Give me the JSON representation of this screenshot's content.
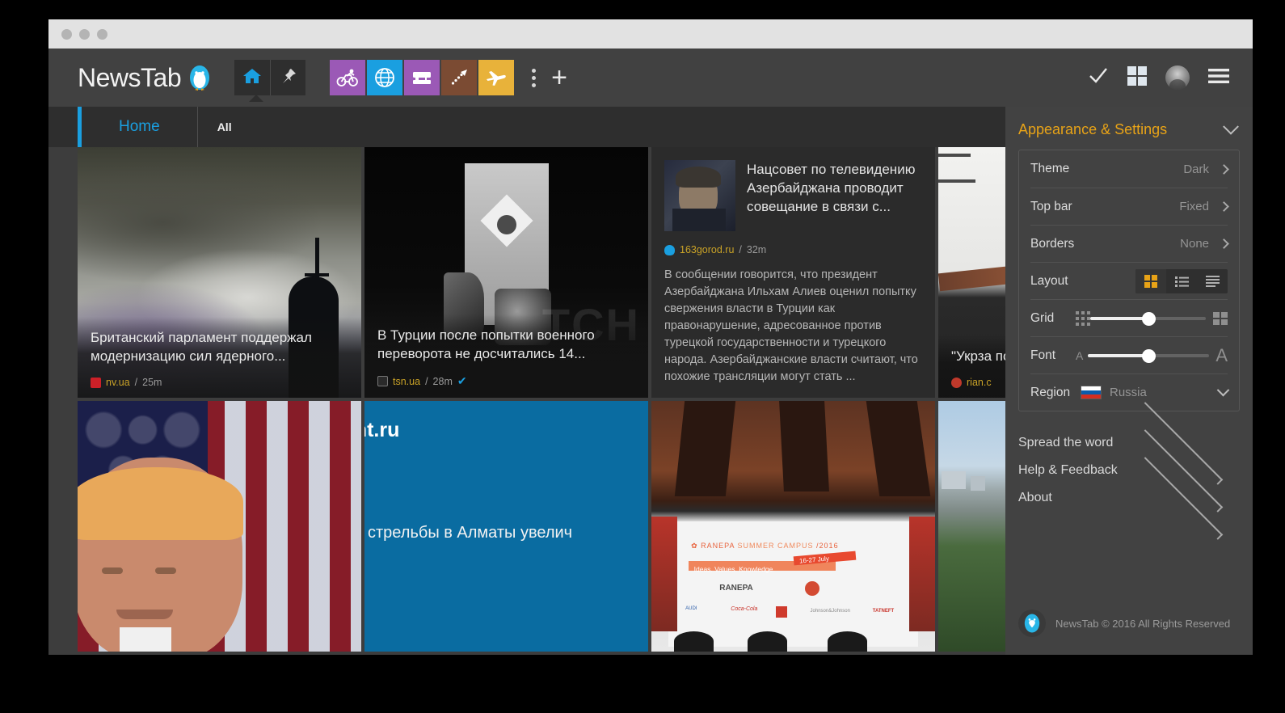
{
  "window": {
    "dots": [
      "close",
      "minimize",
      "maximize"
    ]
  },
  "topbar": {
    "brand": "NewsTab",
    "brand_icon": "penguin-logo",
    "nav": [
      {
        "name": "home",
        "icon": "home-icon",
        "active": true
      },
      {
        "name": "pin",
        "icon": "pin-icon",
        "active": false
      }
    ],
    "categories": [
      {
        "name": "cycling",
        "icon": "bicycle-icon",
        "color": "#9b59b6"
      },
      {
        "name": "world",
        "icon": "globe-icon",
        "color": "#1a9fe0"
      },
      {
        "name": "crafts",
        "icon": "sewing-machine-icon",
        "color": "#9b59b6"
      },
      {
        "name": "trending",
        "icon": "arrow-up-icon",
        "color": "#7b4b33"
      },
      {
        "name": "travel",
        "icon": "airplane-icon",
        "color": "#e8b23a"
      }
    ],
    "more_icon": "kebab-menu-icon",
    "add_label": "+",
    "right_icons": [
      {
        "name": "mark-read",
        "icon": "check-icon"
      },
      {
        "name": "view-grid",
        "icon": "grid-icon"
      },
      {
        "name": "account",
        "icon": "avatar"
      },
      {
        "name": "main-menu",
        "icon": "hamburger-icon"
      }
    ]
  },
  "tabs": [
    {
      "label": "Home",
      "active": true
    },
    {
      "label": "All",
      "active": false
    }
  ],
  "cards": [
    {
      "type": "photo",
      "name": "card-uk-parliament",
      "title": "Британский парламент поддержал модернизацию сил ядерного...",
      "source": "nv.ua",
      "time": "25m",
      "favicon_color": "#cc2028",
      "verified": false,
      "image": "submarine-cloudy-sky"
    },
    {
      "type": "photo",
      "name": "card-turkey-coup",
      "title": "В Турции после попытки военного переворота не досчитались 14...",
      "source": "tsn.ua",
      "time": "28m",
      "favicon_color": "#2a2a2a",
      "verified": true,
      "image": "taksim-monument-bw"
    },
    {
      "type": "text",
      "name": "card-azerbaijan-tv",
      "title": "Нацсовет по телевидению Азербайджана проводит совещание в связи с...",
      "source": "163gorod.ru",
      "time": "32m",
      "favicon_color": "#1a9fe0",
      "body": "В сообщении говорится, что президент Азербайджана Ильхам Алиев оценил попытку свержения власти в Турции как правонарушение, адресованное против турецкой государственности и турецкого народа. Азербайджанские власти считают, что похожие трансляции могут стать ...",
      "image": "erdogan-portrait-thumb"
    },
    {
      "type": "photo",
      "name": "card-ukrzaliznytsia",
      "title": "\"Укрза похищ",
      "source": "rian.c",
      "time": "",
      "favicon_color": "#c0392b",
      "verified": false,
      "image": "white-building-interior",
      "clipped": true
    },
    {
      "type": "photo",
      "name": "card-trump",
      "title": "",
      "source": "",
      "time": "",
      "image": "trump-us-flag"
    },
    {
      "type": "blue",
      "name": "card-kommersant-almaty",
      "brand": "sant.ru",
      "title": "отв стрельбы в Алматы увелич",
      "bg_color": "#0a6ca1"
    },
    {
      "type": "photo",
      "name": "card-ranepa-campus",
      "title": "",
      "source": "",
      "time": "",
      "image": "ranepa-summer-campus-2016"
    },
    {
      "type": "photo",
      "name": "card-city-river",
      "title": "",
      "source": "",
      "time": "",
      "image": "city-river-aerial",
      "clipped": true
    }
  ],
  "settings": {
    "title": "Appearance & Settings",
    "collapse_icon": "chevron-down-icon",
    "rows": [
      {
        "label": "Theme",
        "value": "Dark",
        "type": "link"
      },
      {
        "label": "Top bar",
        "value": "Fixed",
        "type": "link"
      },
      {
        "label": "Borders",
        "value": "None",
        "type": "link"
      }
    ],
    "layout": {
      "label": "Layout",
      "options": [
        {
          "name": "grid-layout",
          "icon": "grid-icon",
          "active": true
        },
        {
          "name": "list-layout",
          "icon": "list-icon",
          "active": false
        },
        {
          "name": "compact-layout",
          "icon": "lines-icon",
          "active": false
        }
      ],
      "accent": "#e8a317"
    },
    "grid_slider": {
      "label": "Grid",
      "value": 50,
      "min_icon": "dense-grid-icon",
      "max_icon": "large-grid-icon"
    },
    "font_slider": {
      "label": "Font",
      "value": 50,
      "min_icon": "small-a-icon",
      "max_icon": "large-a-icon"
    },
    "region": {
      "label": "Region",
      "value": "Russia",
      "flag": "russia-flag",
      "chevron": "chevron-down-icon"
    },
    "links": [
      {
        "label": "Spread the word"
      },
      {
        "label": "Help & Feedback"
      },
      {
        "label": "About"
      }
    ],
    "footer": {
      "logo": "penguin-logo",
      "text": "NewsTab © 2016 All Rights Reserved"
    }
  }
}
